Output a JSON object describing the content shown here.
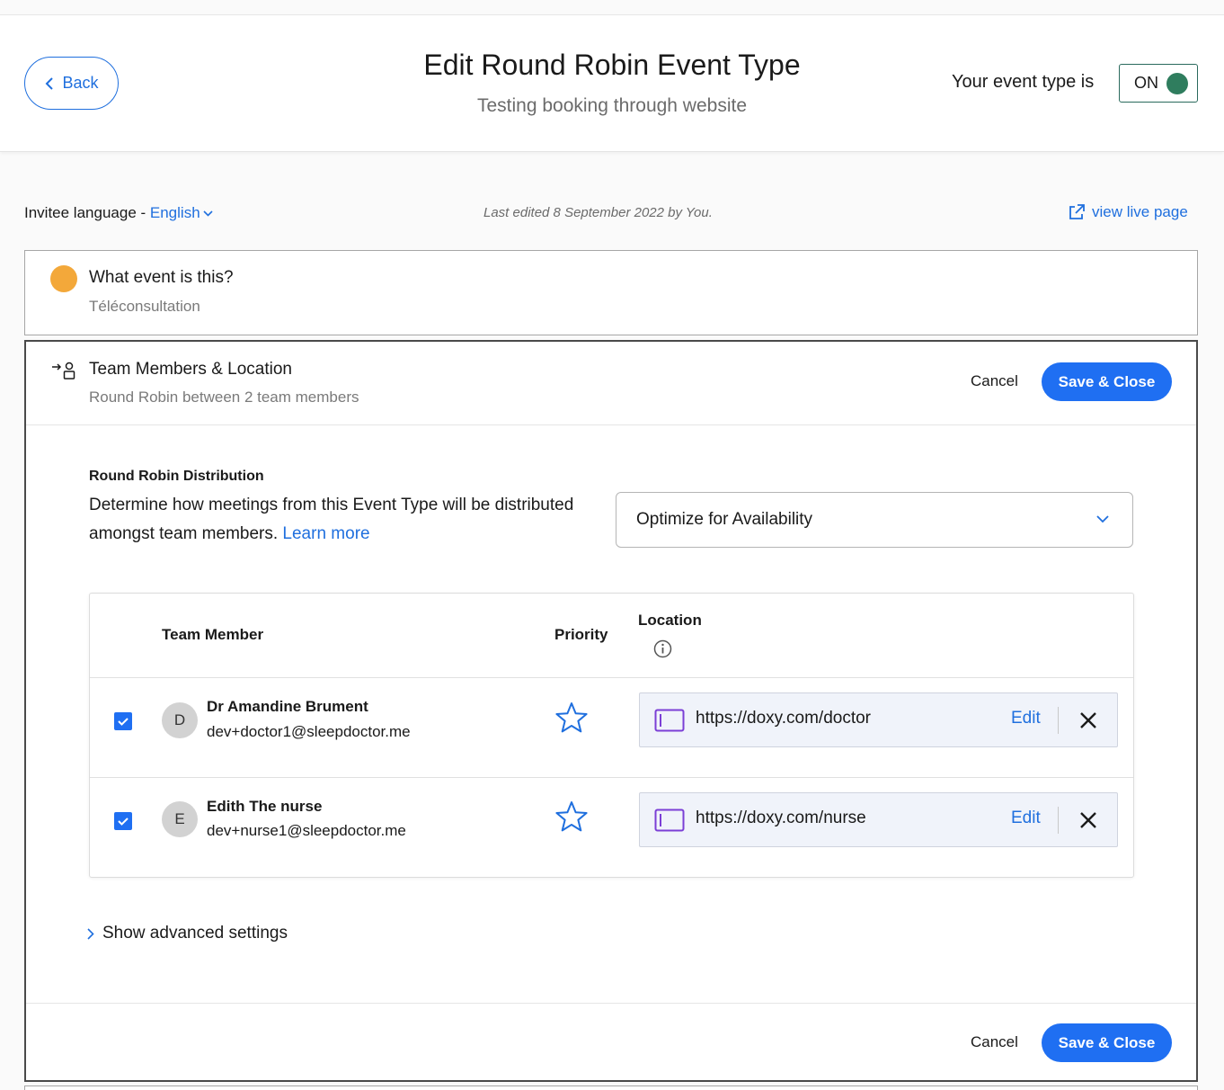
{
  "header": {
    "back_label": "Back",
    "title": "Edit Round Robin Event Type",
    "subtitle": "Testing booking through website",
    "status_label": "Your event type is",
    "toggle_label": "ON",
    "toggle_color": "#2f7d5e"
  },
  "meta": {
    "language_prefix": "Invitee language -",
    "language_value": "English",
    "last_edited": "Last edited 8 September 2022 by You.",
    "live_page_label": "view live page"
  },
  "what_event": {
    "title": "What event is this?",
    "subtitle": "Téléconsultation",
    "dot_color": "#f3a83a"
  },
  "team_section": {
    "title": "Team Members & Location",
    "subtitle": "Round Robin between 2 team members",
    "cancel_label": "Cancel",
    "save_label": "Save & Close",
    "distribution": {
      "title": "Round Robin Distribution",
      "description": "Determine how meetings from this Event Type will be distributed amongst team members.",
      "learn_more": "Learn more",
      "selected_option": "Optimize for Availability"
    },
    "table": {
      "headers": {
        "member": "Team Member",
        "priority": "Priority",
        "location": "Location"
      },
      "rows": [
        {
          "checked": true,
          "initial": "D",
          "name": "Dr Amandine Brument",
          "email": "dev+doctor1@sleepdoctor.me",
          "location_url": "https://doxy.com/doctor",
          "edit_label": "Edit"
        },
        {
          "checked": true,
          "initial": "E",
          "name": "Edith The nurse",
          "email": "dev+nurse1@sleepdoctor.me",
          "location_url": "https://doxy.com/nurse",
          "edit_label": "Edit"
        }
      ]
    },
    "advanced_label": "Show advanced settings"
  },
  "colors": {
    "accent": "#1f6fde",
    "primary_button": "#1f6ff2"
  }
}
